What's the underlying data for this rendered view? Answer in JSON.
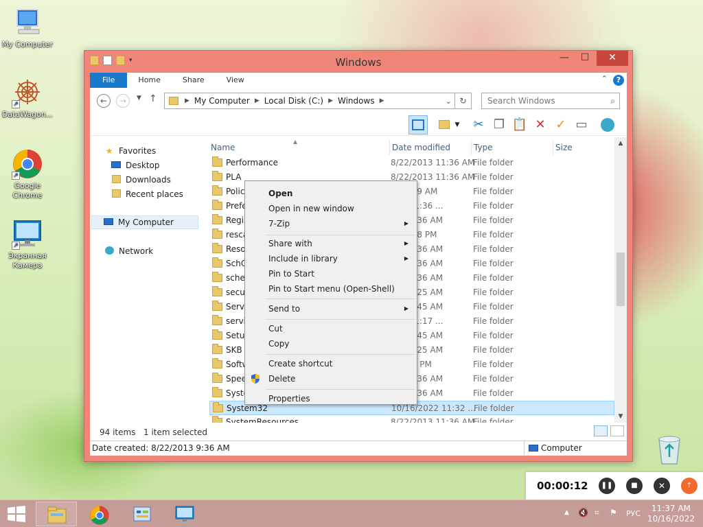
{
  "desktop": {
    "icons": [
      {
        "label": "My Computer"
      },
      {
        "label": "DataWagon..."
      },
      {
        "label": "Google Chrome"
      },
      {
        "label": "Экранная Камера"
      }
    ]
  },
  "window": {
    "title": "Windows",
    "close_glyph": "✕",
    "min_glyph": "—",
    "max_glyph": "☐",
    "tabs": [
      "File",
      "Home",
      "Share",
      "View"
    ],
    "address": [
      "My Computer",
      "Local Disk (C:)",
      "Windows"
    ],
    "search_placeholder": "Search Windows"
  },
  "navpane": {
    "favorites": "Favorites",
    "items": [
      "Desktop",
      "Downloads",
      "Recent places"
    ],
    "my_computer": "My Computer",
    "network": "Network"
  },
  "columns": {
    "name": "Name",
    "date": "Date modified",
    "type": "Type",
    "size": "Size"
  },
  "files": [
    {
      "name": "Performance",
      "date": "8/22/2013 11:36 AM",
      "type": "File folder"
    },
    {
      "name": "PLA",
      "date": "8/22/2013 11:36 AM",
      "type": "File folder"
    },
    {
      "name": "Policy",
      "date": "2 12:59 AM",
      "type": "File folder"
    },
    {
      "name": "Prefe",
      "date": "022 11:36 ...",
      "type": "File folder"
    },
    {
      "name": "Regis",
      "date": "13 11:36 AM",
      "type": "File folder"
    },
    {
      "name": "resca",
      "date": "2 10:38 PM",
      "type": "File folder"
    },
    {
      "name": "Resou",
      "date": "13 11:36 AM",
      "type": "File folder"
    },
    {
      "name": "SchC",
      "date": "13 11:36 AM",
      "type": "File folder"
    },
    {
      "name": "scher",
      "date": "13 11:36 AM",
      "type": "File folder"
    },
    {
      "name": "secur",
      "date": "014 3:25 AM",
      "type": "File folder"
    },
    {
      "name": "Servic",
      "date": "13 10:45 AM",
      "type": "File folder"
    },
    {
      "name": "servic",
      "date": "014 11:17 ...",
      "type": "File folder"
    },
    {
      "name": "Setup",
      "date": "13 10:45 AM",
      "type": "File folder"
    },
    {
      "name": "SKB",
      "date": "014 3:25 AM",
      "type": "File folder"
    },
    {
      "name": "Softw",
      "date": "2 9:42 PM",
      "type": "File folder"
    },
    {
      "name": "Speec",
      "date": "13 11:36 AM",
      "type": "File folder"
    },
    {
      "name": "Syste",
      "date": "13 11:36 AM",
      "type": "File folder"
    },
    {
      "name": "System32",
      "date": "10/16/2022 11:32 ...",
      "type": "File folder"
    },
    {
      "name": "SystemResources",
      "date": "8/22/2013 11:36 AM",
      "type": "File folder"
    }
  ],
  "status": {
    "count": "94 items",
    "selected": "1 item selected",
    "date_created": "Date created: 8/22/2013 9:36 AM",
    "computer": "Computer"
  },
  "context_menu": {
    "items": [
      {
        "label": "Open",
        "bold": true
      },
      {
        "label": "Open in new window"
      },
      {
        "label": "7-Zip",
        "submenu": true
      },
      {
        "label": "Share with",
        "submenu": true
      },
      {
        "label": "Include in library",
        "submenu": true
      },
      {
        "label": "Pin to Start"
      },
      {
        "label": "Pin to Start menu (Open-Shell)"
      },
      {
        "label": "Send to",
        "submenu": true
      },
      {
        "label": "Cut"
      },
      {
        "label": "Copy"
      },
      {
        "label": "Create shortcut"
      },
      {
        "label": "Delete"
      },
      {
        "label": "Properties"
      }
    ],
    "submenu_glyph": "▶"
  },
  "recorder": {
    "time": "00:00:12"
  },
  "taskbar": {
    "lang": "РУС",
    "time": "11:37 AM",
    "date": "10/16/2022"
  },
  "colors": {
    "accent": "#1979ca",
    "window_frame": "#f0857a",
    "selection": "#cce8ff"
  }
}
